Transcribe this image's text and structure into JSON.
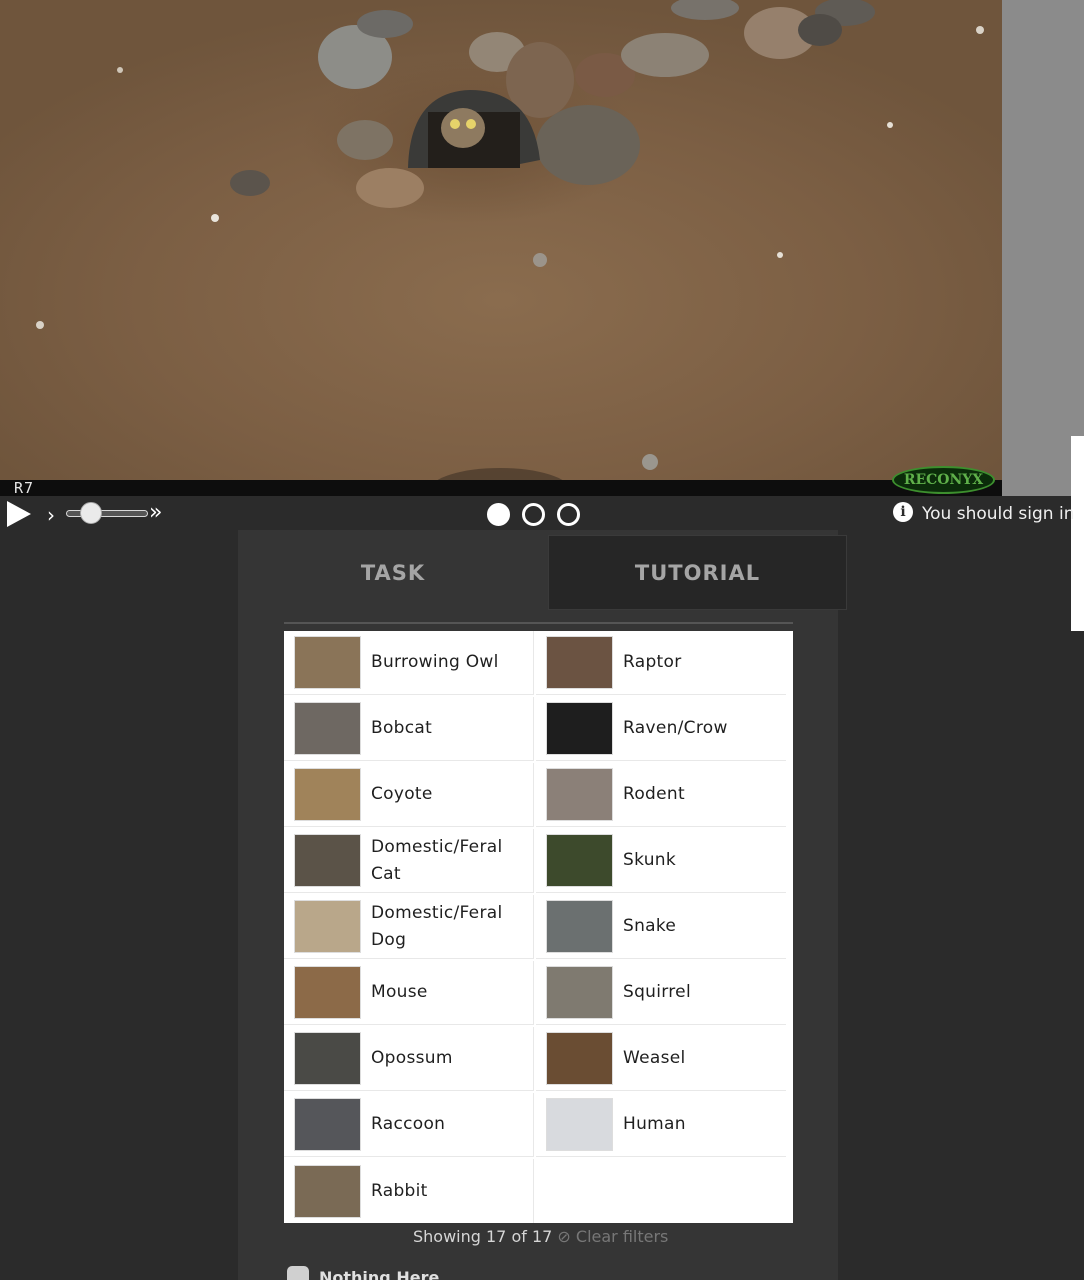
{
  "subject": {
    "camera_model": "R7",
    "brand": "RECONYX"
  },
  "controls": {
    "play_icon": "play-icon",
    "step_icon": "chevron-right-icon",
    "fast_forward_icon": "double-chevron-right-icon",
    "frames": 3,
    "active_frame": 1,
    "signin_notice": "You should sign in"
  },
  "tabs": [
    {
      "label": "TASK"
    },
    {
      "label": "TUTORIAL"
    }
  ],
  "choices": [
    {
      "label": "Burrowing Owl",
      "color": "#8a7458"
    },
    {
      "label": "Raptor",
      "color": "#6b5342"
    },
    {
      "label": "Bobcat",
      "color": "#6e6862"
    },
    {
      "label": "Raven/Crow",
      "color": "#1e1e1e"
    },
    {
      "label": "Coyote",
      "color": "#a0835a"
    },
    {
      "label": "Rodent",
      "color": "#8b8078"
    },
    {
      "label": "Domestic/Feral Cat",
      "color": "#5b5348"
    },
    {
      "label": "Skunk",
      "color": "#3d4a2c"
    },
    {
      "label": "Domestic/Feral Dog",
      "color": "#b9a78a"
    },
    {
      "label": "Snake",
      "color": "#6b7070"
    },
    {
      "label": "Mouse",
      "color": "#8c6a48"
    },
    {
      "label": "Squirrel",
      "color": "#7f7a70"
    },
    {
      "label": "Opossum",
      "color": "#4a4a46"
    },
    {
      "label": "Weasel",
      "color": "#6a4d33"
    },
    {
      "label": "Raccoon",
      "color": "#55565a"
    },
    {
      "label": "Human",
      "color": "#d8dade"
    },
    {
      "label": "Rabbit",
      "color": "#7a6a55"
    }
  ],
  "filter": {
    "showing": "Showing 17 of 17",
    "clear_label": "Clear filters",
    "clear_icon": "ban-icon"
  },
  "nothing_here": {
    "label": "Nothing Here"
  }
}
